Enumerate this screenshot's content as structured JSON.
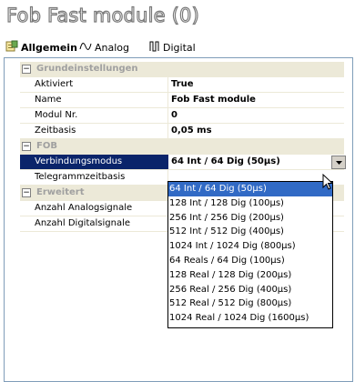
{
  "window": {
    "title": "Fob Fast module (0)"
  },
  "tabs": [
    {
      "label": "Allgemein",
      "icon": "settings-page-icon",
      "active": true
    },
    {
      "label": "Analog",
      "icon": "analog-wave-icon",
      "active": false
    },
    {
      "label": "Digital",
      "icon": "digital-pulse-icon",
      "active": false
    }
  ],
  "grid": {
    "categories": [
      {
        "label": "Grundeinstellungen",
        "expander": "⊟",
        "rows": [
          {
            "key": "Aktiviert",
            "value": "True"
          },
          {
            "key": "Name",
            "value": "Fob Fast module"
          },
          {
            "key": "Modul Nr.",
            "value": "0"
          },
          {
            "key": "Zeitbasis",
            "value": "0,05 ms"
          }
        ]
      },
      {
        "label": "FOB",
        "expander": "⊟",
        "rows": [
          {
            "key": "Verbindungsmodus",
            "value": "64 Int / 64 Dig (50µs)"
          },
          {
            "key": "Telegrammzeitbasis",
            "value": ""
          }
        ]
      },
      {
        "label": "Erweitert",
        "expander": "⊟",
        "rows": [
          {
            "key": "Anzahl Analogsignale",
            "value": ""
          },
          {
            "key": "Anzahl Digitalsignale",
            "value": ""
          }
        ]
      }
    ]
  },
  "dropdown": {
    "options": [
      "64 Int / 64 Dig (50µs)",
      "128 Int / 128 Dig (100µs)",
      "256 Int / 256 Dig (200µs)",
      "512 Int / 512 Dig (400µs)",
      "1024 Int / 1024 Dig (800µs)",
      "64 Reals / 64 Dig (100µs)",
      "128 Real / 128 Dig (200µs)",
      "256 Real / 256 Dig (400µs)",
      "512 Real / 512 Dig (800µs)",
      "1024 Real / 1024 Dig (1600µs)"
    ],
    "selected_index": 0
  },
  "colors": {
    "selection": "#0a246a",
    "highlight": "#316ac5",
    "category_bg": "#ece9d8"
  }
}
